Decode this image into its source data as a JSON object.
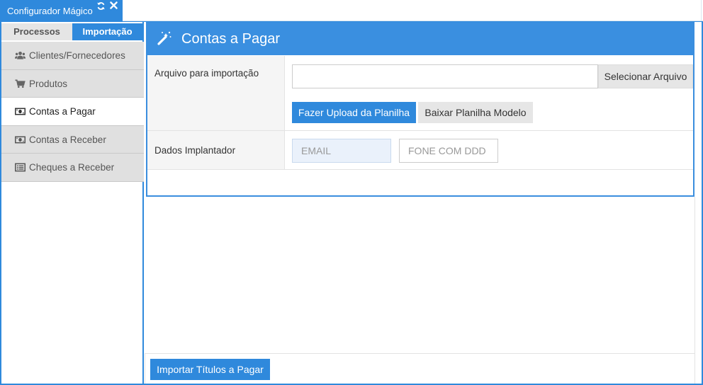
{
  "window": {
    "title": "Configurador Mágico",
    "refresh_icon": "refresh-icon",
    "close_icon": "close-icon"
  },
  "sidebar": {
    "tabs": [
      {
        "label": "Processos",
        "active": false
      },
      {
        "label": "Importação",
        "active": true
      }
    ],
    "items": [
      {
        "label": "Clientes/Fornecedores",
        "icon": "users-icon",
        "active": false
      },
      {
        "label": "Produtos",
        "icon": "cart-icon",
        "active": false
      },
      {
        "label": "Contas a Pagar",
        "icon": "money-icon",
        "active": true
      },
      {
        "label": "Contas a Receber",
        "icon": "money-icon",
        "active": false
      },
      {
        "label": "Cheques a Receber",
        "icon": "list-icon",
        "active": false
      }
    ]
  },
  "panel": {
    "title": "Contas a Pagar",
    "icon": "magic-wand-icon",
    "file_row": {
      "label": "Arquivo para importação",
      "file_value": "",
      "select_button": "Selecionar Arquivo",
      "upload_button": "Fazer Upload da Planilha",
      "model_button": "Baixar Planilha Modelo"
    },
    "implant_row": {
      "label": "Dados Implantador",
      "email_placeholder": "EMAIL",
      "phone_placeholder": "FONE COM DDD"
    }
  },
  "footer": {
    "import_button": "Importar Títulos a Pagar"
  },
  "colors": {
    "accent": "#2f89dc",
    "sidebar_bg": "#e0e0e0",
    "label_bg": "#f5f5f5"
  }
}
